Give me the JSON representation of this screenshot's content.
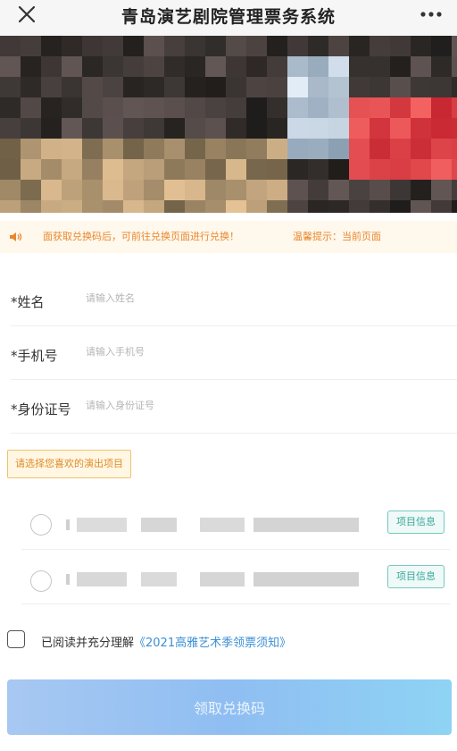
{
  "header": {
    "title": "青岛演艺剧院管理票务系统",
    "close_icon": "close-icon",
    "more_icon": "more-dots-icon"
  },
  "notice": {
    "icon": "speaker-icon",
    "text": "面获取兑换码后，可前往兑换页面进行兑换！",
    "tip": "温馨提示：当前页面"
  },
  "form": {
    "fields": [
      {
        "label": "*姓名",
        "placeholder": "请输入姓名"
      },
      {
        "label": "*手机号",
        "placeholder": "请输入手机号"
      },
      {
        "label": "*身份证号",
        "placeholder": "请输入身份证号"
      }
    ]
  },
  "shows": {
    "section_label": "请选择您喜欢的演出项目",
    "items": [
      {
        "info_label": "项目信息",
        "selected": false
      },
      {
        "info_label": "项目信息",
        "selected": false
      }
    ]
  },
  "agreement": {
    "prefix": "已阅读并充分理解",
    "link": "《2021高雅艺术季领票须知》",
    "checked": false
  },
  "submit": {
    "label": "领取兑换码"
  },
  "colors": {
    "accent_orange": "#e8872f",
    "info_green": "#3aa79a",
    "link_blue": "#3b8fd6",
    "button_blue": "#8fbef2"
  }
}
